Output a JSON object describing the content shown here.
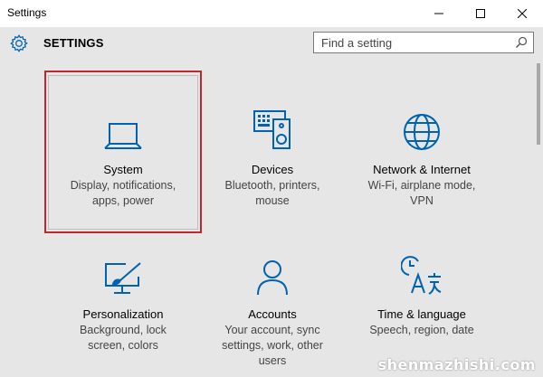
{
  "window": {
    "title": "Settings"
  },
  "header": {
    "heading": "SETTINGS"
  },
  "search": {
    "placeholder": "Find a setting"
  },
  "tiles": [
    {
      "title": "System",
      "description": "Display, notifications, apps, power",
      "icon": "laptop-icon",
      "selected": true
    },
    {
      "title": "Devices",
      "description": "Bluetooth, printers, mouse",
      "icon": "keyboard-speaker-icon"
    },
    {
      "title": "Network & Internet",
      "description": "Wi-Fi, airplane mode, VPN",
      "icon": "globe-icon"
    },
    {
      "title": "Personalization",
      "description": "Background, lock screen, colors",
      "icon": "paint-monitor-icon"
    },
    {
      "title": "Accounts",
      "description": "Your account, sync settings, work, other users",
      "icon": "user-icon"
    },
    {
      "title": "Time & language",
      "description": "Speech, region, date",
      "icon": "clock-language-icon"
    }
  ],
  "watermark": "shenmazhishi.com",
  "colors": {
    "accent": "#0063b1",
    "selection_border": "#c0272d",
    "background": "#e6e6e6"
  }
}
